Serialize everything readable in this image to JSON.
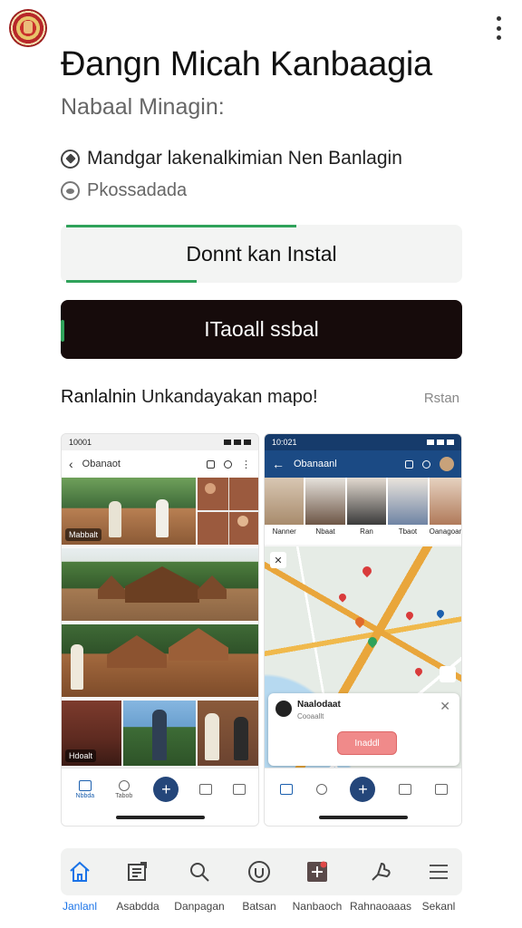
{
  "header": {
    "title": "Đangn Micah Kanbaagia",
    "subtitle": "Nabaal Minagin:"
  },
  "info": [
    {
      "icon": "check-circle-icon",
      "text": "Mandgar lakenalkimian Nen Banlagin"
    },
    {
      "icon": "shield-circle-icon",
      "text": "Pkossadada"
    }
  ],
  "buttons": {
    "open_label": "Donnt kan Instal",
    "install_label": "ITaoall ssbal"
  },
  "screenshots_section": {
    "title_start": "Ranlalnin ",
    "title_rest": "Unkandayakan mapo!",
    "link": "Rstan"
  },
  "screenshot_left": {
    "status_time": "10001",
    "appbar_title": "Obanaot",
    "tile_labels": [
      "Mabbalt",
      "Hdoalt"
    ]
  },
  "screenshot_right": {
    "status_time": "10:021",
    "appbar_title": "Obanaanl",
    "thumb_captions": [
      "Nanner",
      "Nbaat",
      "Ran",
      "Tbaot",
      "Oanagoan"
    ],
    "popup_name": "Naalodaat",
    "popup_sub": "Cooaallt",
    "popup_button": "Inaddl"
  },
  "mini_nav_labels": [
    "Nbbda",
    "Tabob",
    "",
    "",
    ""
  ],
  "bottom_nav": [
    {
      "icon": "home-icon",
      "label": "Janlanl",
      "active": true
    },
    {
      "icon": "newspaper-icon",
      "label": "Asabdda"
    },
    {
      "icon": "search-icon",
      "label": "Danpagan"
    },
    {
      "icon": "refresh-circle-icon",
      "label": "Batsan"
    },
    {
      "icon": "add-square-icon",
      "label": "Nanbaoch"
    },
    {
      "icon": "thumbs-icon",
      "label": "Rahnaoaaas"
    },
    {
      "icon": "menu-icon",
      "label": "Sekanl"
    }
  ],
  "colors": {
    "accent_green": "#2fa25a",
    "install_bg": "#160b0b",
    "app_blue": "#1b4a84",
    "active_nav": "#1a73e8"
  }
}
